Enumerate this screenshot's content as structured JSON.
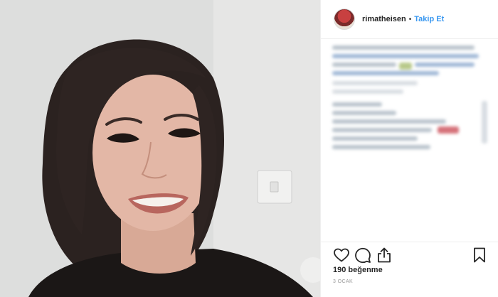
{
  "post": {
    "username": "rimatheisen",
    "separator": "•",
    "follow_label": "Takip Et",
    "likes_text": "190 beğenme",
    "date_text": "3 OCAK"
  },
  "icons": {
    "like": "heart-icon",
    "comment": "comment-icon",
    "share": "share-icon",
    "save": "bookmark-icon"
  },
  "colors": {
    "link": "#3897f0",
    "text": "#262626",
    "muted": "#999999",
    "border": "#efefef"
  }
}
